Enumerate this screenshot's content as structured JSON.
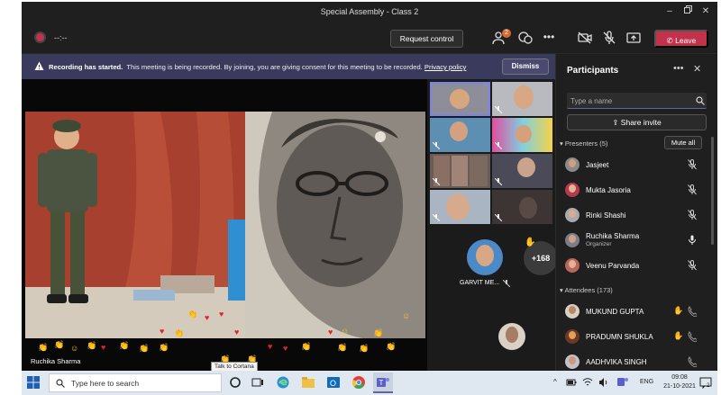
{
  "window": {
    "title": "Special Assembly - Class 2"
  },
  "toolbar": {
    "recording_time": "--:--",
    "request_control_label": "Request control",
    "participants_badge": "2",
    "leave_label": "Leave",
    "leave_color": "#c4314b"
  },
  "banner": {
    "bold_text": "Recording has started.",
    "body_text": "This meeting is being recorded. By joining, you are giving consent for this meeting to be recorded.",
    "link_text": "Privacy policy",
    "dismiss_label": "Dismiss",
    "background": "#3a3a5c"
  },
  "stage": {
    "presenter_name": "Ruchika Sharma"
  },
  "gallery": {
    "main_tile_name": "GARVIT ME...",
    "overflow_count": "+168"
  },
  "panel": {
    "title": "Participants",
    "search_placeholder": "Type a name",
    "share_invite_label": "Share invite",
    "presenters_header": "Presenters (5)",
    "mute_all_label": "Mute all",
    "presenters": [
      {
        "name": "Jasjeet",
        "role": "",
        "mic": "muted"
      },
      {
        "name": "Mukta Jasoria",
        "role": "",
        "mic": "muted"
      },
      {
        "name": "Rinki Shashi",
        "role": "",
        "mic": "muted"
      },
      {
        "name": "Ruchika Sharma",
        "role": "Organizer",
        "mic": "on"
      },
      {
        "name": "Veenu Parvanda",
        "role": "",
        "mic": "muted"
      }
    ],
    "attendees_header": "Attendees (173)",
    "attendees": [
      {
        "name": "MUKUND GUPTA",
        "hand": "raised"
      },
      {
        "name": "PRADUMN SHUKLA",
        "hand": "raised"
      },
      {
        "name": "AADHVIKA SINGH",
        "hand": ""
      }
    ],
    "accent_color": "#6264a7"
  },
  "taskbar": {
    "search_placeholder": "Type here to search",
    "tooltip": "Talk to Cortana",
    "language": "ENG",
    "time": "09:08",
    "date": "21-10-2021",
    "notification_count": "2"
  }
}
